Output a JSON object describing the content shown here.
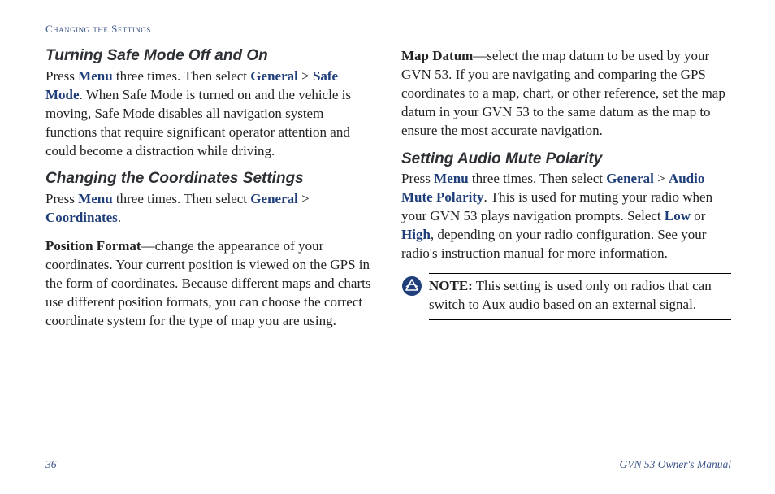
{
  "header": "Changing the Settings",
  "col1": {
    "s1": {
      "heading": "Turning Safe Mode Off and On",
      "t1": "Press ",
      "k1": "Menu",
      "t2": " three times. Then select ",
      "k2": "General",
      "sep": " > ",
      "k3": "Safe Mode",
      "t3": ". When Safe Mode is turned on and the vehicle is moving, Safe Mode disables all navigation system functions that require significant operator attention and could become a distraction while driving."
    },
    "s2": {
      "heading": "Changing the Coordinates Settings",
      "t1": "Press ",
      "k1": "Menu",
      "t2": " three times. Then select ",
      "k2": "General",
      "sep": " > ",
      "k3": "Coordinates",
      "t3": "."
    },
    "s3": {
      "lead": "Position Format",
      "body": "—change the appearance of your coordinates. Your current position is viewed on the GPS in the form of coordinates. Because different maps and charts use different position formats, you can choose the correct coordinate system for the type of map you are using."
    }
  },
  "col2": {
    "s1": {
      "lead": "Map Datum",
      "body": "—select the map datum to be used by your GVN 53. If you are navigating and comparing the GPS coordinates to a map, chart, or other reference, set the map datum in your GVN 53 to the same datum as the map to ensure the most accurate navigation."
    },
    "s2": {
      "heading": "Setting Audio Mute Polarity",
      "t1": "Press ",
      "k1": "Menu",
      "t2": " three times. Then select ",
      "k2": "General",
      "sep": " > ",
      "k3": "Audio Mute Polarity",
      "t3": ". This is used for muting your radio when your GVN 53 plays navigation prompts. Select ",
      "k4": "Low",
      "t4": " or ",
      "k5": "High",
      "t5": ", depending on your radio configuration. See your radio's instruction manual for more information."
    },
    "note": {
      "label": "NOTE:",
      "body": " This setting is used only on radios that can switch to Aux audio based on an external signal."
    }
  },
  "footer": {
    "page": "36",
    "manual": "GVN 53 Owner's Manual"
  }
}
